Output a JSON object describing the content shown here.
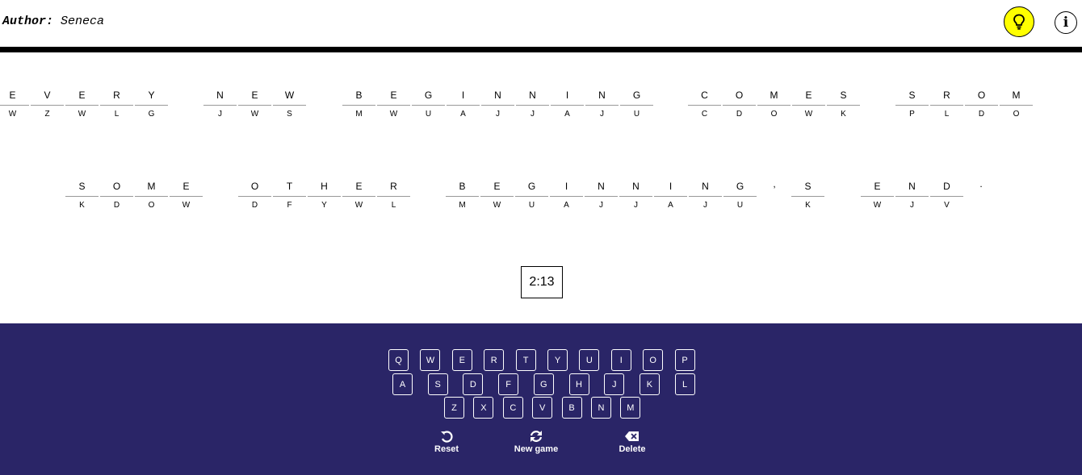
{
  "header": {
    "author_label": "Author:",
    "author_name": "Seneca",
    "hint_icon": "lightbulb-icon",
    "info_icon": "info-icon",
    "info_glyph": "i"
  },
  "puzzle": {
    "lines": [
      {
        "words": [
          {
            "letters": [
              "E",
              "V",
              "E",
              "R",
              "Y"
            ],
            "codes": [
              "W",
              "Z",
              "W",
              "L",
              "G"
            ]
          },
          {
            "letters": [
              "N",
              "E",
              "W"
            ],
            "codes": [
              "J",
              "W",
              "S"
            ]
          },
          {
            "letters": [
              "B",
              "E",
              "G",
              "I",
              "N",
              "N",
              "I",
              "N",
              "G"
            ],
            "codes": [
              "M",
              "W",
              "U",
              "A",
              "J",
              "J",
              "A",
              "J",
              "U"
            ]
          },
          {
            "letters": [
              "C",
              "O",
              "M",
              "E",
              "S"
            ],
            "codes": [
              "C",
              "D",
              "O",
              "W",
              "K"
            ]
          },
          {
            "letters": [
              "S",
              "R",
              "O",
              "M"
            ],
            "codes": [
              "P",
              "L",
              "D",
              "O"
            ]
          }
        ]
      },
      {
        "words": [
          {
            "letters": [
              "S",
              "O",
              "M",
              "E"
            ],
            "codes": [
              "K",
              "D",
              "O",
              "W"
            ]
          },
          {
            "letters": [
              "O",
              "T",
              "H",
              "E",
              "R"
            ],
            "codes": [
              "D",
              "F",
              "Y",
              "W",
              "L"
            ]
          },
          {
            "letters": [
              "B",
              "E",
              "G",
              "I",
              "N",
              "N",
              "I",
              "N",
              "G"
            ],
            "codes": [
              "M",
              "W",
              "U",
              "A",
              "J",
              "J",
              "A",
              "J",
              "U"
            ]
          },
          {
            "punct": ","
          },
          {
            "letters": [
              "S"
            ],
            "codes": [
              "K"
            ]
          },
          {
            "letters": [
              "E",
              "N",
              "D"
            ],
            "codes": [
              "W",
              "J",
              "V"
            ]
          },
          {
            "punct": "."
          }
        ]
      }
    ]
  },
  "timer": "2:13",
  "keyboard": {
    "rows": [
      [
        "Q",
        "W",
        "E",
        "R",
        "T",
        "Y",
        "U",
        "I",
        "O",
        "P"
      ],
      [
        "A",
        "S",
        "D",
        "F",
        "G",
        "H",
        "J",
        "K",
        "L"
      ],
      [
        "Z",
        "X",
        "C",
        "V",
        "B",
        "N",
        "M"
      ]
    ]
  },
  "actions": {
    "reset": "Reset",
    "new_game": "New game",
    "delete": "Delete"
  },
  "colors": {
    "panel": "#2a2567",
    "hint": "#ffff00"
  }
}
